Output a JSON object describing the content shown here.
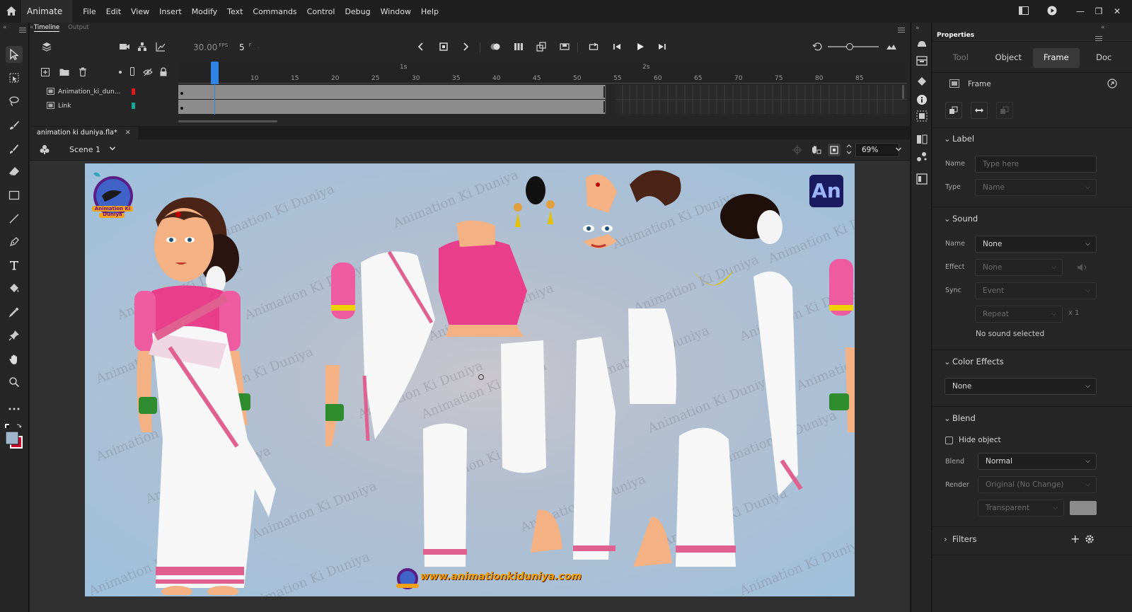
{
  "app": {
    "name": "Animate"
  },
  "menu": [
    "File",
    "Edit",
    "View",
    "Insert",
    "Modify",
    "Text",
    "Commands",
    "Control",
    "Debug",
    "Window",
    "Help"
  ],
  "timeline": {
    "tabs": [
      "Timeline",
      "Output"
    ],
    "fps": "30.00",
    "fps_unit": "FPS",
    "frame": "5",
    "frame_unit": "F",
    "ruler_ticks": [
      "10",
      "15",
      "20",
      "25",
      "30",
      "35",
      "40",
      "45",
      "50",
      "55",
      "60",
      "65",
      "70",
      "75",
      "80",
      "85"
    ],
    "seconds_marks": [
      "1s",
      "2s"
    ],
    "layers": [
      {
        "name": "Animation_ki_dun...",
        "color": "#e01b1b"
      },
      {
        "name": "Link",
        "color": "#16a39a"
      }
    ]
  },
  "document": {
    "tab_title": "animation ki duniya.fla*",
    "scene": "Scene 1",
    "zoom": "69%"
  },
  "stage": {
    "watermark": "Animation Ki Duniya",
    "badge": "An",
    "logo_text": "Animation Ki Duniya",
    "website": "www.animationkiduniya.com"
  },
  "properties": {
    "title": "Properties",
    "tabs": [
      "Tool",
      "Object",
      "Frame",
      "Doc"
    ],
    "active_tab": "Frame",
    "frame_label": "Frame",
    "label_section": "Label",
    "name_label": "Name",
    "name_placeholder": "Type here",
    "type_label": "Type",
    "type_value": "Name",
    "sound_section": "Sound",
    "sound_name_label": "Name",
    "sound_name_value": "None",
    "effect_label": "Effect",
    "effect_value": "None",
    "sync_label": "Sync",
    "sync_value": "Event",
    "repeat_value": "Repeat",
    "repeat_count": "x 1",
    "no_sound": "No sound selected",
    "color_effects_section": "Color Effects",
    "color_effect_value": "None",
    "blend_section": "Blend",
    "hide_object": "Hide object",
    "blend_label": "Blend",
    "blend_value": "Normal",
    "render_label": "Render",
    "render_value": "Original (No Change)",
    "transparent_value": "Transparent",
    "filters_section": "Filters"
  },
  "colors": {
    "accent": "#2f84e6",
    "panel": "#262626",
    "stage_bg": "#9ec0dc",
    "badge_bg": "#1a1b5e",
    "badge_fg": "#9bb5ff"
  }
}
